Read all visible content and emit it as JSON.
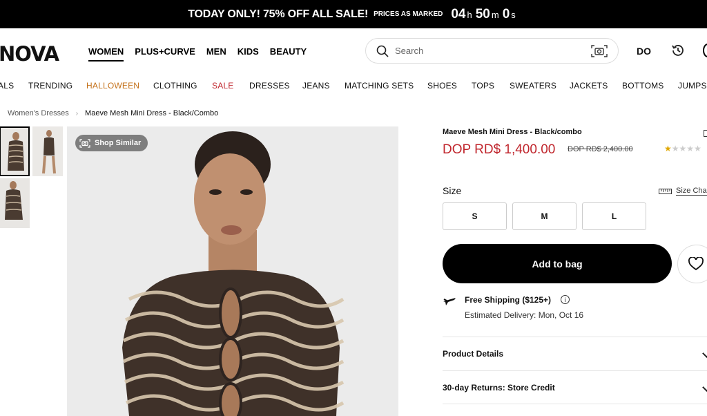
{
  "promo": {
    "headline": "TODAY ONLY! 75% OFF ALL SALE!",
    "sub": "PRICES AS MARKED",
    "timer": {
      "hours": "04",
      "hours_unit": "h",
      "minutes": "50",
      "minutes_unit": "m",
      "seconds": "0",
      "seconds_unit": "s"
    }
  },
  "header": {
    "logo": "NOVA",
    "nav": [
      "WOMEN",
      "PLUS+CURVE",
      "MEN",
      "KIDS",
      "BEAUTY"
    ],
    "active_nav": "WOMEN",
    "search_placeholder": "Search",
    "country": "DO"
  },
  "categories": [
    "ALS",
    "TRENDING",
    "HALLOWEEN",
    "CLOTHING",
    "SALE",
    "DRESSES",
    "JEANS",
    "MATCHING SETS",
    "SHOES",
    "TOPS",
    "SWEATERS",
    "JACKETS",
    "BOTTOMS",
    "JUMPS"
  ],
  "breadcrumb": {
    "parent": "Women's Dresses",
    "current": "Maeve Mesh Mini Dress - Black/Combo"
  },
  "gallery": {
    "shop_similar": "Shop Similar"
  },
  "product": {
    "name": "Maeve Mesh Mini Dress - Black/combo",
    "price": "DOP RD$ 1,400.00",
    "old_price": "DOP RD$ 2,400.00",
    "rating": 1,
    "rating_max": 5,
    "size_label": "Size",
    "size_chart": "Size Cha",
    "sizes": [
      "S",
      "M",
      "L"
    ],
    "add_to_bag": "Add to bag",
    "shipping": "Free Shipping ($125+)",
    "delivery": "Estimated Delivery: Mon, Oct 16",
    "accordions": [
      "Product Details",
      "30-day Returns: Store Credit"
    ]
  },
  "colors": {
    "sale_red": "#c0262d",
    "halloween_orange": "#c4711a",
    "star": "#e0a800"
  }
}
